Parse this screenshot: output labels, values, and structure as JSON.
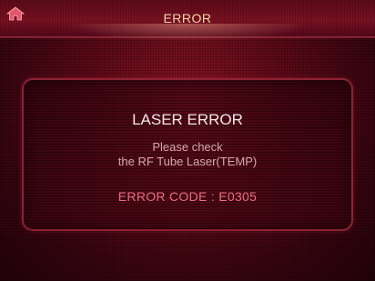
{
  "header": {
    "title": "ERROR",
    "home_icon": "home-icon"
  },
  "dialog": {
    "title": "LASER ERROR",
    "message_line1": "Please check",
    "message_line2": "the RF Tube Laser(TEMP)",
    "code_label": "ERROR CODE : E0305"
  },
  "colors": {
    "background": "#5e0a17",
    "title_text": "#f0d8a8",
    "dialog_border": "#8c2233",
    "message_text": "#d8a8b0",
    "code_text": "#ee6e80"
  }
}
